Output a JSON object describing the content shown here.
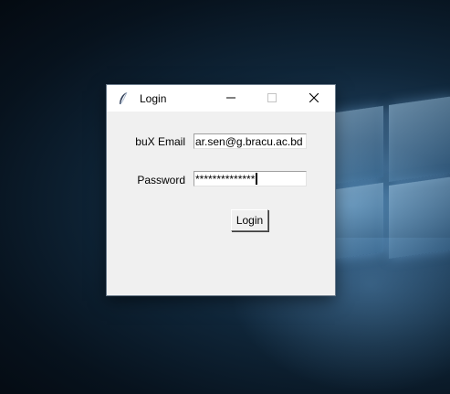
{
  "window": {
    "title": "Login",
    "app_icon": "feather-icon",
    "controls": {
      "minimize_icon": "minimize-icon",
      "maximize_icon": "maximize-icon",
      "close_icon": "close-icon"
    }
  },
  "form": {
    "email_label": "buX Email",
    "email_value": "ar.sen@g.bracu.ac.bd",
    "password_label": "Password",
    "password_value": "**************",
    "submit_label": "Login"
  },
  "colors": {
    "window_bg": "#f0f0f0",
    "titlebar_bg": "#ffffff",
    "desktop_accent": "#3e6f96"
  }
}
